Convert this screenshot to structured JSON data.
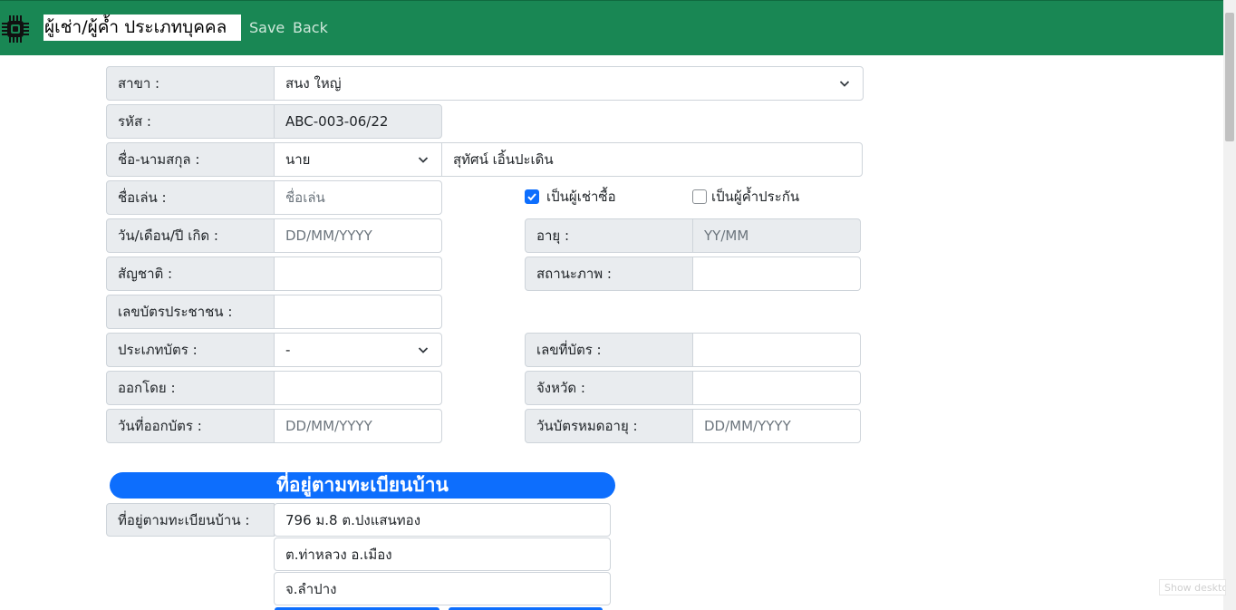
{
  "header": {
    "title": "ผู้เช่า/ผู้ค้ำ ประเภทบุคคล",
    "save_label": "Save",
    "back_label": "Back",
    "icon": "chip-icon",
    "bar_color": "#198754"
  },
  "form": {
    "branch": {
      "label": "สาขา :",
      "value": "สนง ใหญ่"
    },
    "code": {
      "label": "รหัส :",
      "value": "ABC-003-06/22"
    },
    "name": {
      "label": "ชื่อ-นามสกุล :",
      "prefix": "นาย",
      "fullname": "สุทัศน์ เอิ้นปะเดิน"
    },
    "nickname": {
      "label": "ชื่อเล่น :",
      "placeholder": "ชื่อเล่น"
    },
    "is_lessee": {
      "label": "เป็นผู้เช่าซื้อ",
      "checked": true
    },
    "is_guarantor": {
      "label": "เป็นผู้ค้ำประกัน",
      "checked": false
    },
    "birthdate": {
      "label": "วัน/เดือน/ปี เกิด :",
      "placeholder": "DD/MM/YYYY"
    },
    "age": {
      "label": "อายุ :",
      "placeholder": "YY/MM"
    },
    "nationality": {
      "label": "สัญชาติ :",
      "value": ""
    },
    "status": {
      "label": "สถานะภาพ :",
      "value": ""
    },
    "id_number": {
      "label": "เลขบัตรประชาชน :",
      "value": ""
    },
    "card_type": {
      "label": "ประเภทบัตร :",
      "value": "-"
    },
    "card_number": {
      "label": "เลขที่บัตร :",
      "value": ""
    },
    "issued_by": {
      "label": "ออกโดย :",
      "value": ""
    },
    "province": {
      "label": "จังหวัด :",
      "value": ""
    },
    "issue_date": {
      "label": "วันที่ออกบัตร :",
      "placeholder": "DD/MM/YYYY"
    },
    "expiry_date": {
      "label": "วันบัตรหมดอายุ :",
      "placeholder": "DD/MM/YYYY"
    }
  },
  "address_section": {
    "title": "ที่อยู่ตามทะเบียนบ้าน",
    "label": "ที่อยู่ตามทะเบียนบ้าน :",
    "line1": "796 ม.8 ต.ปงแสนทอง",
    "line2": "ต.ท่าหลวง อ.เมือง",
    "line3": "จ.ลำปาง",
    "pill_color": "#0d6efd"
  },
  "taskbar": {
    "show_desktop": "Show desktop"
  }
}
